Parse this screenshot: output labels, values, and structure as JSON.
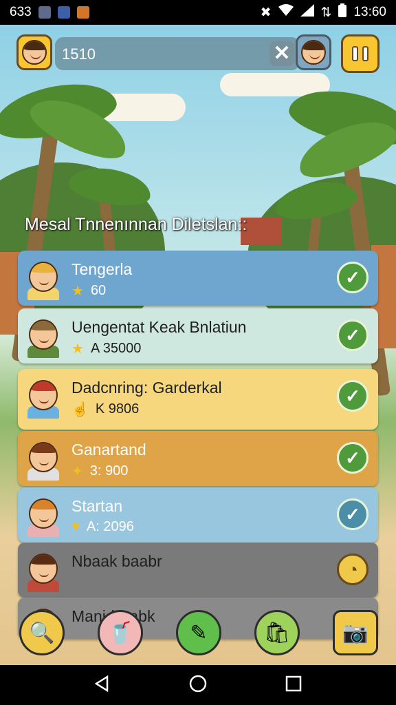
{
  "status_bar": {
    "left_text": "633",
    "time": "13:60"
  },
  "top_bar": {
    "search_value": "1510",
    "close_label": "✕"
  },
  "heading": "Mesal Tnnenınnan Diletslan::",
  "quests": [
    {
      "title": "Tengerla",
      "meta_icon": "star-icon",
      "meta_icon_glyph": "★",
      "meta_icon2": "coin-icon",
      "meta_value": "60",
      "status": "done",
      "bg": "#6fa6cf",
      "dark": false
    },
    {
      "title": "Uengentat Keak Bnlatiun",
      "meta_icon": "star-icon",
      "meta_icon_glyph": "★",
      "meta_value": "A 35000",
      "status": "done",
      "bg": "#cfe8df",
      "dark": true
    },
    {
      "title": "Dadcnring: Garderkal",
      "meta_icon": "hand-icon",
      "meta_icon_glyph": "☝",
      "meta_value": "K 9806",
      "status": "done",
      "bg": "#f6d77d",
      "dark": true
    },
    {
      "title": "Ganartand",
      "meta_icon": "sparkle-icon",
      "meta_icon_glyph": "✦",
      "meta_value": "3: 900",
      "status": "done",
      "bg": "#e0a448",
      "dark": false
    },
    {
      "title": "Startan",
      "meta_icon": "heart-icon",
      "meta_icon_glyph": "♥",
      "meta_value": "A: 2096",
      "status": "pending",
      "bg": "#99c6df",
      "dark": false
    },
    {
      "title": "Nbaak baabr",
      "meta_icon": "",
      "meta_icon_glyph": "",
      "meta_value": "",
      "status": "locked",
      "bg": "#7a7a7a",
      "dark": true
    },
    {
      "title": "Manid Babk",
      "meta_icon": "",
      "meta_icon_glyph": "",
      "meta_value": "",
      "status": "locked",
      "bg": "#8a8a8a",
      "dark": true
    }
  ],
  "bottom_buttons": [
    {
      "name": "magnify-leaf-button",
      "glyph": "🔍",
      "color": "#f1c94a"
    },
    {
      "name": "cup-button",
      "glyph": "🥤",
      "color": "#f2b7b7"
    },
    {
      "name": "brush-button",
      "glyph": "✎",
      "color": "#5fbf4a"
    },
    {
      "name": "bag-button",
      "glyph": "🛍",
      "color": "#9ed25a"
    },
    {
      "name": "camera-button",
      "glyph": "📷",
      "color": "#f1c94a"
    }
  ],
  "colors": {
    "accent_yellow": "#f8c630",
    "check_green": "#4f9a3a",
    "pending_teal": "#4a8ea8"
  }
}
